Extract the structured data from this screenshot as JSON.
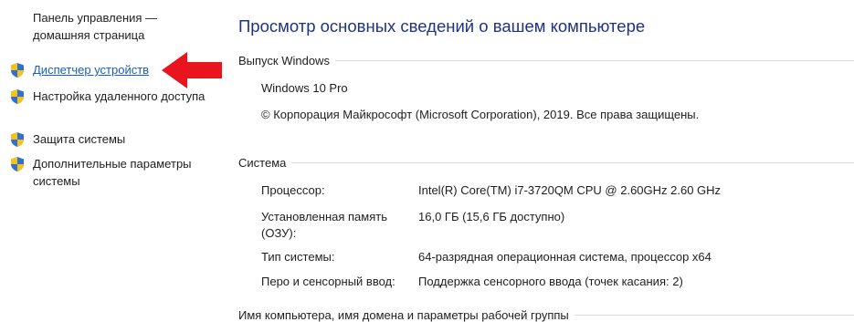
{
  "sidebar": {
    "home_link": "Панель управления — домашняя страница",
    "items": [
      {
        "label": "Диспетчер устройств",
        "icon": "uac-shield-icon"
      },
      {
        "label": "Настройка удаленного доступа",
        "icon": "uac-shield-icon"
      },
      {
        "label": "Защита системы",
        "icon": "uac-shield-icon"
      },
      {
        "label": "Дополнительные параметры системы",
        "icon": "uac-shield-icon"
      }
    ]
  },
  "main": {
    "title": "Просмотр основных сведений о вашем компьютере",
    "windows_edition": {
      "header": "Выпуск Windows",
      "edition": "Windows 10 Pro",
      "copyright": "© Корпорация Майкрософт (Microsoft Corporation), 2019. Все права защищены."
    },
    "system": {
      "header": "Система",
      "rows": [
        {
          "key": "Процессор:",
          "value": "Intel(R) Core(TM) i7-3720QM CPU @ 2.60GHz   2.60 GHz"
        },
        {
          "key": "Установленная память (ОЗУ):",
          "value": "16,0 ГБ (15,6 ГБ доступно)"
        },
        {
          "key": "Тип системы:",
          "value": "64-разрядная операционная система, процессор x64"
        },
        {
          "key": "Перо и сенсорный ввод:",
          "value": "Поддержка сенсорного ввода (точек касания: 2)"
        }
      ]
    },
    "computer_name_section": {
      "header": "Имя компьютера, имя домена и параметры рабочей группы"
    }
  },
  "colors": {
    "title": "#1e3287",
    "link": "#1a5fb4",
    "arrow": "#e8141e",
    "shield_blue": "#2f6fd6",
    "shield_yellow": "#f3c318"
  }
}
